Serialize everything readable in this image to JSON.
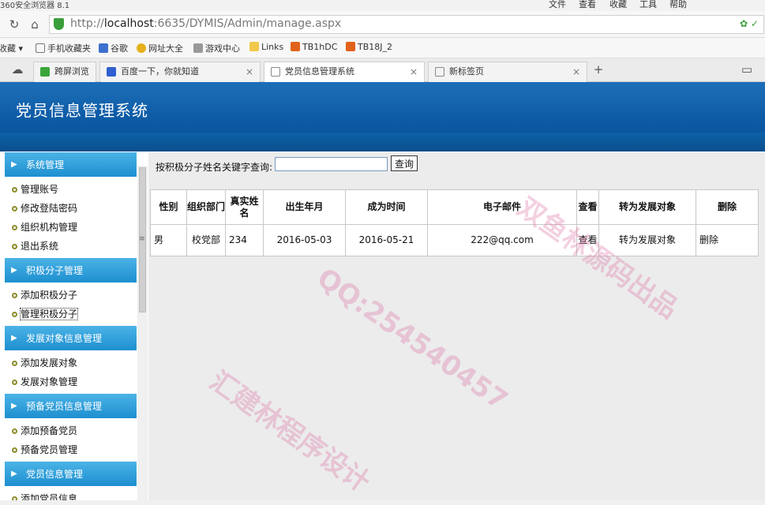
{
  "browser": {
    "app_title": "360安全浏览器 8.1",
    "menu": [
      "文件",
      "查看",
      "收藏",
      "工具",
      "帮助"
    ],
    "url_prefix": "http://",
    "url_host": "localhost",
    "url_rest": ":6635/DYMIS/Admin/manage.aspx",
    "bookmarks": [
      "收藏",
      "手机收藏夹",
      "谷歌",
      "网址大全",
      "游戏中心",
      "Links",
      "TB1hDC",
      "TB18J_2"
    ],
    "tabs": [
      {
        "label": "跨屏浏览"
      },
      {
        "label": "百度一下，你就知道"
      },
      {
        "label": "党员信息管理系统"
      },
      {
        "label": "新标签页"
      }
    ]
  },
  "app": {
    "title": "党员信息管理系统"
  },
  "sidebar": {
    "groups": [
      {
        "title": "系统管理",
        "items": [
          "管理账号",
          "修改登陆密码",
          "组织机构管理",
          "退出系统"
        ]
      },
      {
        "title": "积极分子管理",
        "items": [
          "添加积极分子",
          "管理积极分子"
        ]
      },
      {
        "title": "发展对象信息管理",
        "items": [
          "添加发展对象",
          "发展对象管理"
        ]
      },
      {
        "title": "预备党员信息管理",
        "items": [
          "添加预备党员",
          "预备党员管理"
        ]
      },
      {
        "title": "党员信息管理",
        "items": [
          "添加党员信息"
        ]
      }
    ]
  },
  "search": {
    "label": "按积极分子姓名关键字查询:",
    "value": "",
    "button": "查询"
  },
  "table": {
    "columns": [
      "性别",
      "组织部门",
      "真实姓名",
      "出生年月",
      "成为时间",
      "电子邮件",
      "查看",
      "转为发展对象",
      "删除"
    ],
    "rows": [
      [
        "男",
        "校党部",
        "234",
        "2016-05-03",
        "2016-05-21",
        "222@qq.com",
        "查看",
        "转为发展对象",
        "删除"
      ]
    ]
  },
  "watermark": [
    "QQ:254540457",
    "汇建林程序设计",
    "双鱼林源码出品"
  ]
}
